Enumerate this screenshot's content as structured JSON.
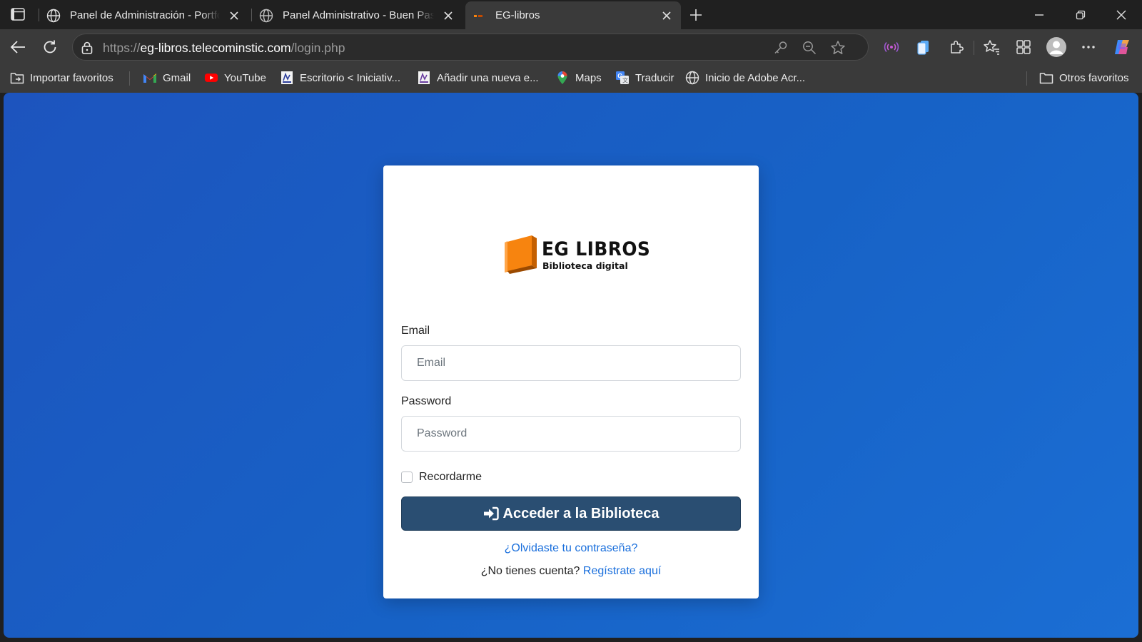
{
  "browser": {
    "tabs": [
      {
        "title": "Panel de Administración - Portfolio",
        "icon": "globe-icon",
        "active": false
      },
      {
        "title": "Panel Administrativo - Buen Pastor",
        "icon": "globe-icon",
        "active": false
      },
      {
        "title": "EG-libros",
        "icon": "eg-favicon",
        "active": true
      }
    ],
    "address": {
      "scheme": "https://",
      "host": "eg-libros.telecominstic.com",
      "path": "/login.php"
    },
    "bookmarks": [
      {
        "label": "Importar favoritos",
        "icon": "import-favorites-icon"
      },
      {
        "label": "Gmail",
        "icon": "gmail-icon"
      },
      {
        "label": "YouTube",
        "icon": "youtube-icon"
      },
      {
        "label": "Escritorio < Iniciativ...",
        "icon": "site-favicon"
      },
      {
        "label": "Añadir una nueva e...",
        "icon": "site-favicon"
      },
      {
        "label": "Maps",
        "icon": "maps-icon"
      },
      {
        "label": "Traducir",
        "icon": "translate-icon"
      },
      {
        "label": "Inicio de Adobe Acr...",
        "icon": "globe-icon"
      }
    ],
    "other_favorites": "Otros favoritos"
  },
  "login": {
    "logo_title": "EG LIBROS",
    "logo_subtitle": "Biblioteca digital",
    "email_label": "Email",
    "email_placeholder": "Email",
    "password_label": "Password",
    "password_placeholder": "Password",
    "remember_label": "Recordarme",
    "submit_label": "Acceder a la Biblioteca",
    "forgot_label": "¿Olvidaste tu contraseña?",
    "no_account_text": "¿No tienes cuenta?",
    "register_label": "Regístrate aquí"
  },
  "colors": {
    "page_background": "#1762c6",
    "button": "#2a4e72",
    "link": "#1a6fdc",
    "logo_orange": "#f7840f"
  }
}
